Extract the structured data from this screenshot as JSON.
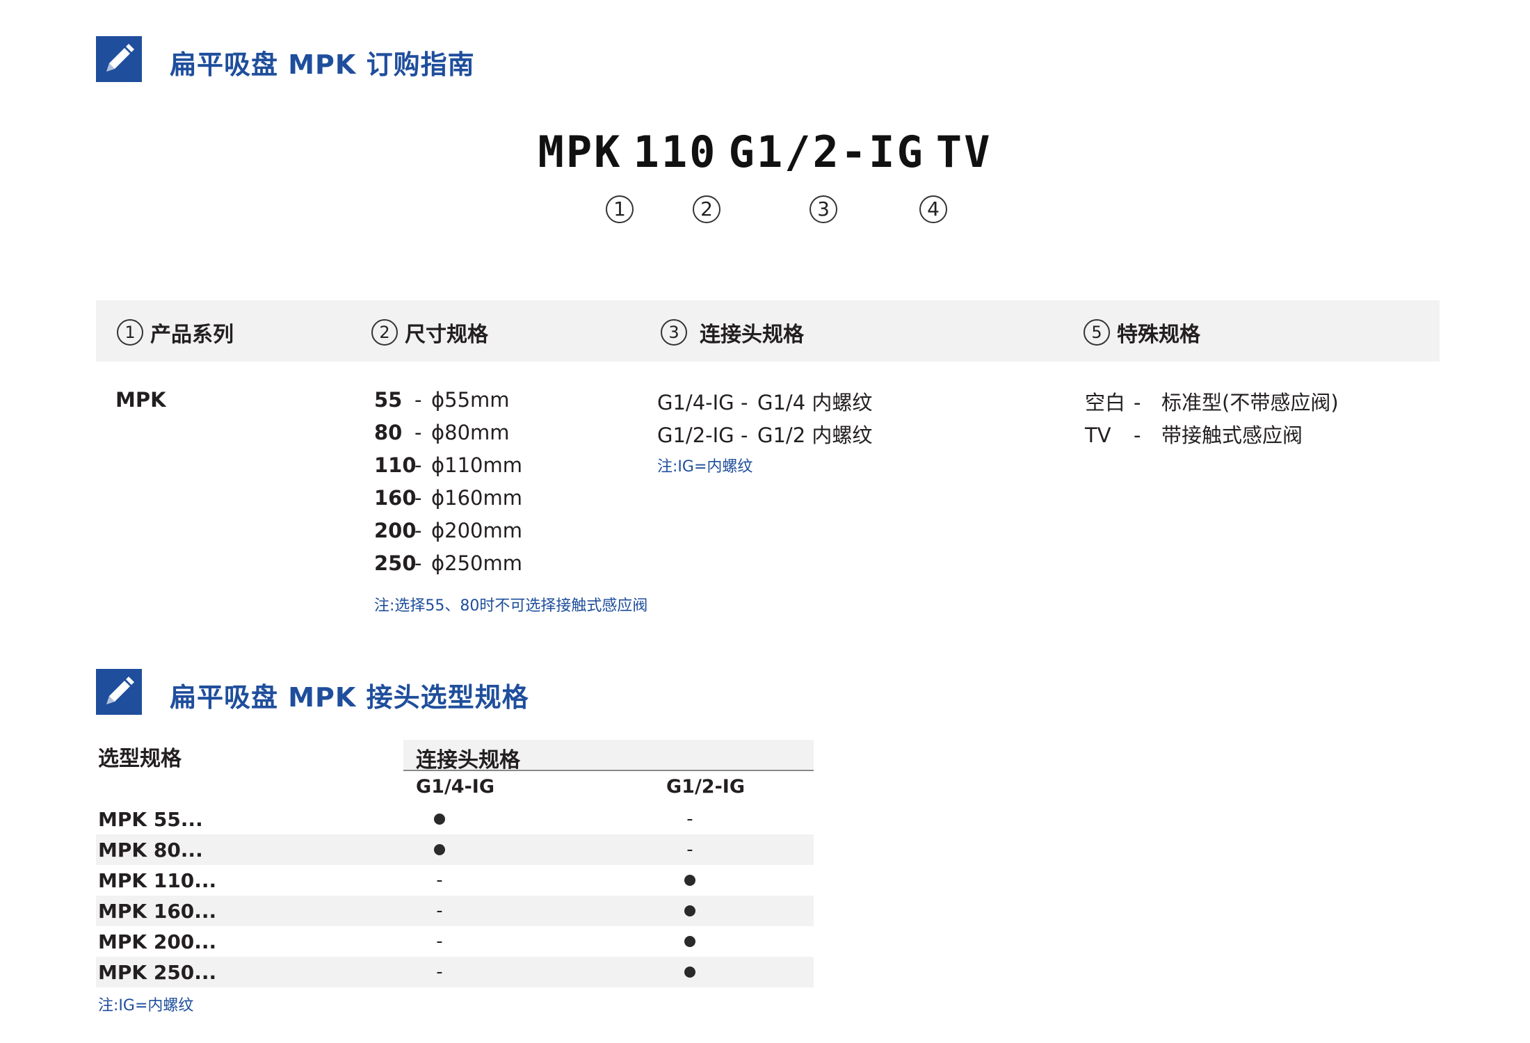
{
  "section1": {
    "title": "扁平吸盘 MPK 订购指南"
  },
  "code": {
    "parts": [
      "MPK",
      "110",
      "G1/2-IG",
      "TV"
    ],
    "markers": [
      "1",
      "2",
      "3",
      "4"
    ]
  },
  "guide": {
    "headers": [
      {
        "num": "1",
        "label": "产品系列"
      },
      {
        "num": "2",
        "label": "尺寸规格"
      },
      {
        "num": "3",
        "label": "连接头规格"
      },
      {
        "num": "5",
        "label": "特殊规格"
      }
    ],
    "series": "MPK",
    "sizes": [
      {
        "code": "55",
        "dash": "-",
        "desc": "ϕ55mm"
      },
      {
        "code": "80",
        "dash": "-",
        "desc": "ϕ80mm"
      },
      {
        "code": "110",
        "dash": "-",
        "desc": "ϕ110mm"
      },
      {
        "code": "160",
        "dash": "-",
        "desc": "ϕ160mm"
      },
      {
        "code": "200",
        "dash": "-",
        "desc": "ϕ200mm"
      },
      {
        "code": "250",
        "dash": "-",
        "desc": "ϕ250mm"
      }
    ],
    "size_note": "注:选择55、80时不可选择接触式感应阀",
    "connections": [
      {
        "code": "G1/4-IG",
        "dash": "-",
        "desc": "G1/4 内螺纹"
      },
      {
        "code": "G1/2-IG",
        "dash": "-",
        "desc": "G1/2 内螺纹"
      }
    ],
    "connection_note": "注:IG=内螺纹",
    "specials": [
      {
        "code": "空白",
        "dash": "-",
        "desc": "标准型(不带感应阀)"
      },
      {
        "code": "TV",
        "dash": "-",
        "desc": "带接触式感应阀"
      }
    ]
  },
  "section2": {
    "title": "扁平吸盘 MPK 接头选型规格"
  },
  "selection": {
    "col_model": "选型规格",
    "col_group": "连接头规格",
    "col_a": "G1/4-IG",
    "col_b": "G1/2-IG",
    "rows": [
      {
        "model": "MPK 55...",
        "a": "dot",
        "b": "-"
      },
      {
        "model": "MPK 80...",
        "a": "dot",
        "b": "-"
      },
      {
        "model": "MPK 110...",
        "a": "-",
        "b": "dot"
      },
      {
        "model": "MPK 160...",
        "a": "-",
        "b": "dot"
      },
      {
        "model": "MPK 200...",
        "a": "-",
        "b": "dot"
      },
      {
        "model": "MPK 250...",
        "a": "-",
        "b": "dot"
      }
    ],
    "note": "注:IG=内螺纹"
  },
  "colors": {
    "accent": "#1f4e9c",
    "row_shade": "#f2f2f2",
    "text": "#231f20"
  },
  "icons": {
    "section": "pencil-icon",
    "available": "filled-dot"
  }
}
